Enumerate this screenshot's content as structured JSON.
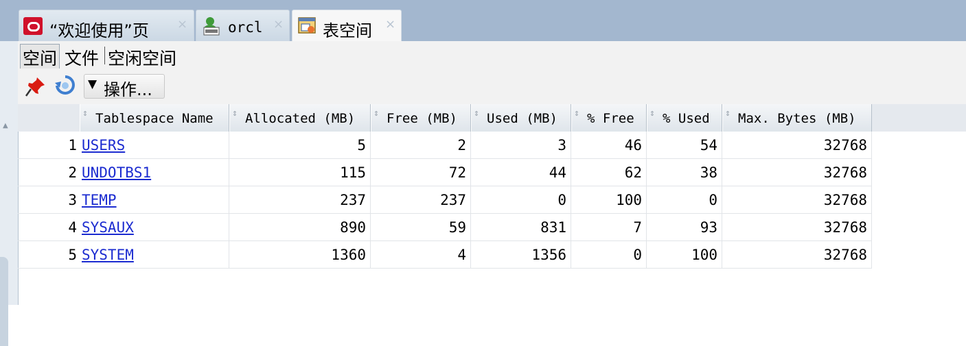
{
  "tabs": [
    {
      "label": "“欢迎使用”页",
      "close": "×",
      "icon": "oracle-logo-icon",
      "active": false
    },
    {
      "label": "orcl",
      "close": "×",
      "icon": "sql-connection-icon",
      "active": false
    },
    {
      "label": "表空间",
      "close": "×",
      "icon": "report-window-icon",
      "active": true
    }
  ],
  "subtabs": [
    "空间",
    "文件",
    "空闲空间"
  ],
  "toolbar": {
    "operations_label": "操作..."
  },
  "table": {
    "columns": [
      "Tablespace Name",
      "Allocated (MB)",
      "Free (MB)",
      "Used (MB)",
      "% Free",
      "% Used",
      "Max. Bytes (MB)"
    ],
    "rows": [
      {
        "n": "1",
        "name": "USERS",
        "allocated": "5",
        "free": "2",
        "used": "3",
        "pct_free": "46",
        "pct_used": "54",
        "max": "32768"
      },
      {
        "n": "2",
        "name": "UNDOTBS1",
        "allocated": "115",
        "free": "72",
        "used": "44",
        "pct_free": "62",
        "pct_used": "38",
        "max": "32768"
      },
      {
        "n": "3",
        "name": "TEMP",
        "allocated": "237",
        "free": "237",
        "used": "0",
        "pct_free": "100",
        "pct_used": "0",
        "max": "32768"
      },
      {
        "n": "4",
        "name": "SYSAUX",
        "allocated": "890",
        "free": "59",
        "used": "831",
        "pct_free": "7",
        "pct_used": "93",
        "max": "32768"
      },
      {
        "n": "5",
        "name": "SYSTEM",
        "allocated": "1360",
        "free": "4",
        "used": "1356",
        "pct_free": "0",
        "pct_used": "100",
        "max": "32768"
      }
    ]
  },
  "colors": {
    "tabbar": "#a3b7cf",
    "link": "#1b2bd0",
    "oracle_red": "#d0112b"
  }
}
